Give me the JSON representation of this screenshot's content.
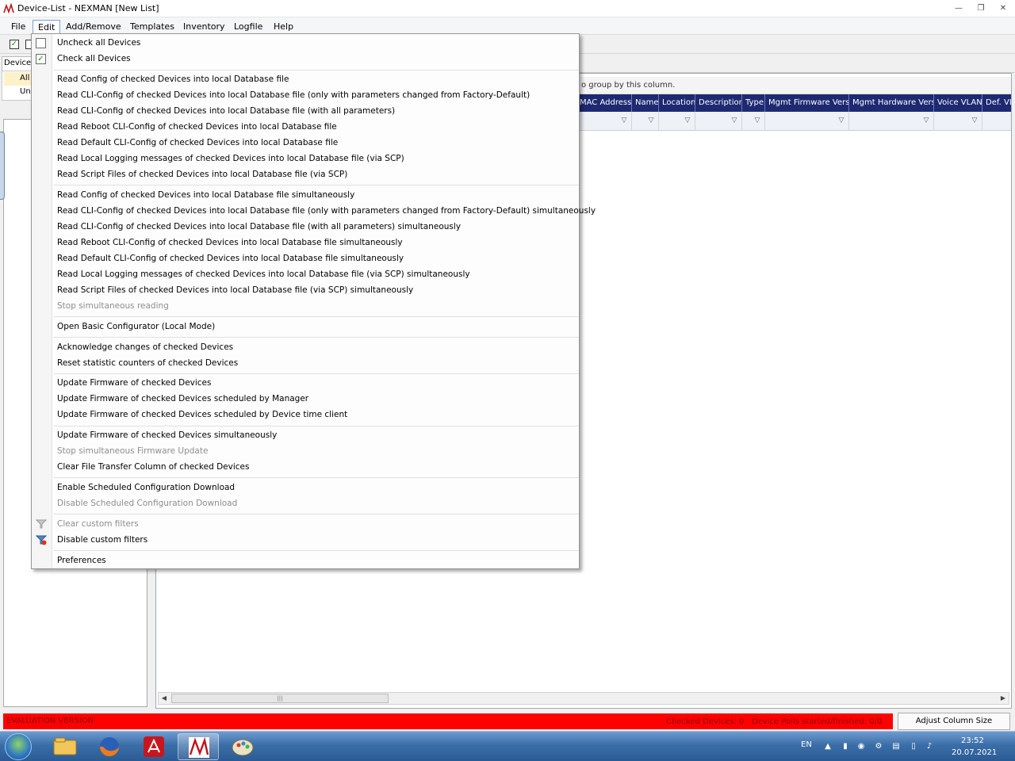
{
  "window": {
    "title": "Device-List - NEXMAN [New List]",
    "controls": [
      "minimize",
      "restore",
      "close"
    ]
  },
  "menubar": {
    "items": [
      "File",
      "Edit",
      "Add/Remove",
      "Templates",
      "Inventory",
      "Logfile",
      "Help"
    ],
    "active": "Edit"
  },
  "left_panel": {
    "tab_label": "Device-L",
    "rows": [
      "All",
      "Un"
    ]
  },
  "grid": {
    "group_hint": "o group by this column.",
    "columns": [
      "MAC Address",
      "Name",
      "Location",
      "Description",
      "Type",
      "Mgmt Firmware Vers.",
      "Mgmt Hardware Vers.",
      "Voice VLAN",
      "Def. VL"
    ]
  },
  "edit_menu": {
    "check_items": [
      {
        "label": "Uncheck all Devices",
        "checked": false
      },
      {
        "label": "Check all Devices",
        "checked": true
      }
    ],
    "group_read": [
      "Read Config of checked Devices into local Database file",
      "Read CLI-Config of checked Devices into local Database file (only with parameters changed from Factory-Default)",
      "Read CLI-Config of checked Devices into local Database file (with all parameters)",
      "Read Reboot CLI-Config of checked Devices into local Database file",
      "Read Default CLI-Config of checked Devices into local Database file",
      "Read Local Logging messages of checked Devices into local Database file (via SCP)",
      "Read Script Files of checked Devices into local Database file (via SCP)"
    ],
    "group_read_sim": [
      "Read Config of checked Devices into local Database file simultaneously",
      "Read CLI-Config of checked Devices into local Database file (only with parameters changed from Factory-Default) simultaneously",
      "Read CLI-Config of checked Devices into local Database file (with all parameters) simultaneously",
      "Read Reboot CLI-Config of checked Devices into local Database file simultaneously",
      "Read Default CLI-Config of checked Devices into local Database file simultaneously",
      "Read Local Logging messages of checked Devices into local Database file (via SCP) simultaneously",
      "Read Script Files of checked Devices into local Database file (via SCP) simultaneously"
    ],
    "stop_reading": "Stop simultaneous reading",
    "open_basic": "Open Basic Configurator (Local Mode)",
    "acknowledge": "Acknowledge changes of checked Devices",
    "reset_counters": "Reset statistic counters of checked Devices",
    "update_fw": "Update Firmware of checked Devices",
    "update_fw_manager": "Update Firmware of checked Devices scheduled by Manager",
    "update_fw_time": "Update Firmware of checked Devices scheduled by Device time client",
    "update_fw_sim": "Update Firmware of checked Devices simultaneously",
    "stop_fw": "Stop simultaneous Firmware Update",
    "clear_transfer": "Clear File Transfer Column of checked Devices",
    "enable_sched": "Enable Scheduled Configuration Download",
    "disable_sched": "Disable Scheduled Configuration Download",
    "clear_filters": "Clear custom filters",
    "disable_filters": "Disable custom filters",
    "preferences": "Preferences"
  },
  "statusbar": {
    "evaluation": "EVALUATION VERSION",
    "checked": "Checked Devices: 0",
    "polls": "Device Polls started/finished: 0/0",
    "adjust_button": "Adjust Column Size",
    "bar_color": "#ff0000"
  },
  "taskbar": {
    "apps": [
      "file-explorer-icon",
      "firefox-icon",
      "acrobat-icon",
      "nexman-icon",
      "paint-icon"
    ],
    "language": "EN",
    "time": "23:52",
    "date": "20.07.2021"
  },
  "colors": {
    "header_bg": "#1d2a72",
    "accent": "#7da2ce"
  }
}
